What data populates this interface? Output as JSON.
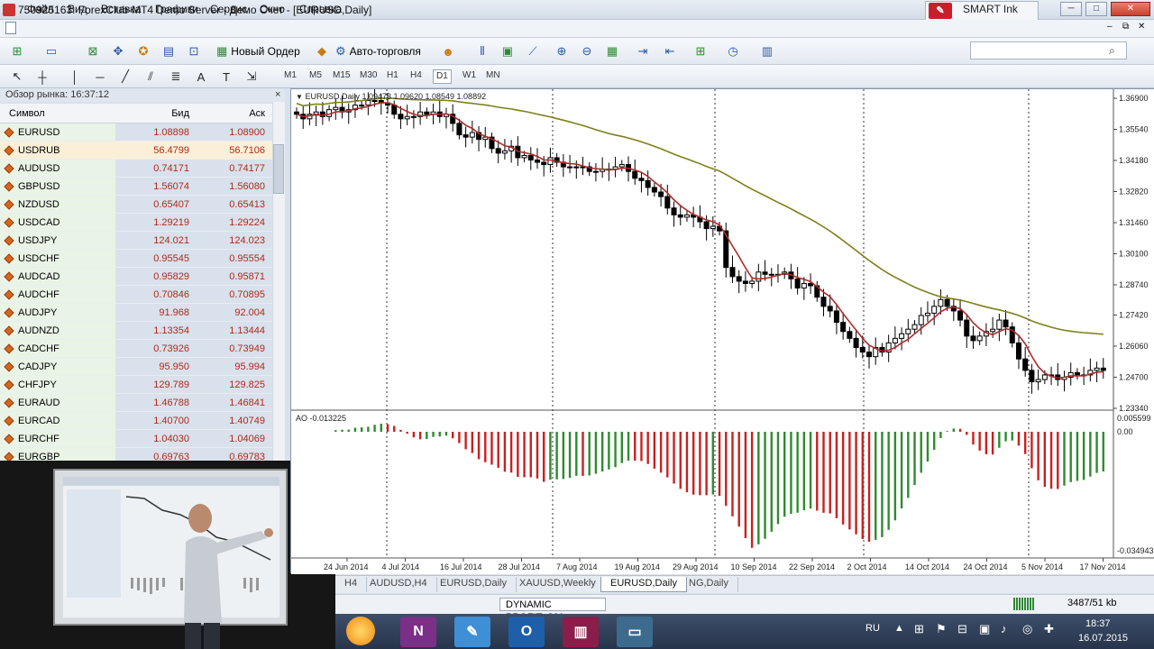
{
  "window": {
    "title": "750925163: ForexClub-MT4 Demo Server - Демо Счет - [EURUSD,Daily]",
    "smart_ink": "SMART Ink",
    "minimize": "─",
    "restore": "□",
    "close": "✕"
  },
  "menu": [
    "Файл",
    "Вид",
    "Вставка",
    "Графики",
    "Сервис",
    "Окно",
    "Справка"
  ],
  "toolbar": {
    "new_order": "Новый Ордер",
    "auto_trading": "Авто-торговля"
  },
  "timeframes": [
    "M1",
    "M5",
    "M15",
    "M30",
    "H1",
    "H4",
    "D1",
    "W1",
    "MN"
  ],
  "active_timeframe": "D1",
  "market_watch": {
    "header": "Обзор рынка: 16:37:12",
    "close": "×",
    "columns": [
      "Символ",
      "Бид",
      "Аск"
    ],
    "rows": [
      {
        "symbol": "EURUSD",
        "bid": "1.08898",
        "ask": "1.08900"
      },
      {
        "symbol": "USDRUB",
        "bid": "56.4799",
        "ask": "56.7106"
      },
      {
        "symbol": "AUDUSD",
        "bid": "0.74171",
        "ask": "0.74177"
      },
      {
        "symbol": "GBPUSD",
        "bid": "1.56074",
        "ask": "1.56080"
      },
      {
        "symbol": "NZDUSD",
        "bid": "0.65407",
        "ask": "0.65413"
      },
      {
        "symbol": "USDCAD",
        "bid": "1.29219",
        "ask": "1.29224"
      },
      {
        "symbol": "USDJPY",
        "bid": "124.021",
        "ask": "124.023"
      },
      {
        "symbol": "USDCHF",
        "bid": "0.95545",
        "ask": "0.95554"
      },
      {
        "symbol": "AUDCAD",
        "bid": "0.95829",
        "ask": "0.95871"
      },
      {
        "symbol": "AUDCHF",
        "bid": "0.70846",
        "ask": "0.70895"
      },
      {
        "symbol": "AUDJPY",
        "bid": "91.968",
        "ask": "92.004"
      },
      {
        "symbol": "AUDNZD",
        "bid": "1.13354",
        "ask": "1.13444"
      },
      {
        "symbol": "CADCHF",
        "bid": "0.73926",
        "ask": "0.73949"
      },
      {
        "symbol": "CADJPY",
        "bid": "95.950",
        "ask": "95.994"
      },
      {
        "symbol": "CHFJPY",
        "bid": "129.789",
        "ask": "129.825"
      },
      {
        "symbol": "EURAUD",
        "bid": "1.46788",
        "ask": "1.46841"
      },
      {
        "symbol": "EURCAD",
        "bid": "1.40700",
        "ask": "1.40749"
      },
      {
        "symbol": "EURCHF",
        "bid": "1.04030",
        "ask": "1.04069"
      },
      {
        "symbol": "EURGBP",
        "bid": "0.69763",
        "ask": "0.69783"
      }
    ]
  },
  "chart": {
    "header": "EURUSD,Daily  1.09473 1.09620 1.08549 1.08892",
    "indicator_label": "AO -0.013225",
    "price_levels": [
      "1.36900",
      "1.35540",
      "1.34180",
      "1.32820",
      "1.31460",
      "1.30100",
      "1.28740",
      "1.27420",
      "1.26060",
      "1.24700",
      "1.23340"
    ],
    "ao_levels": [
      "0.005599",
      "0.00",
      "-0.034943"
    ],
    "date_labels": [
      "24 Jun 2014",
      "4 Jul 2014",
      "16 Jul 2014",
      "28 Jul 2014",
      "7 Aug 2014",
      "19 Aug 2014",
      "29 Aug 2014",
      "10 Sep 2014",
      "22 Sep 2014",
      "2 Oct 2014",
      "14 Oct 2014",
      "24 Oct 2014",
      "5 Nov 2014",
      "17 Nov 2014"
    ],
    "colors": {
      "ma_fast": "#b02a2a",
      "ma_slow": "#7f7f1a",
      "ao_up": "#2e8b2e",
      "ao_down": "#c8201f"
    }
  },
  "chart_data": {
    "type": "candlestick",
    "symbol": "EURUSD",
    "timeframe": "Daily",
    "ylim": [
      1.2334,
      1.369
    ],
    "close_series": [
      1.362,
      1.36,
      1.362,
      1.363,
      1.361,
      1.364,
      1.365,
      1.363,
      1.364,
      1.366,
      1.366,
      1.368,
      1.368,
      1.367,
      1.366,
      1.362,
      1.36,
      1.361,
      1.361,
      1.363,
      1.362,
      1.363,
      1.361,
      1.362,
      1.358,
      1.353,
      1.352,
      1.354,
      1.351,
      1.352,
      1.347,
      1.345,
      1.346,
      1.348,
      1.343,
      1.344,
      1.342,
      1.341,
      1.34,
      1.343,
      1.341,
      1.339,
      1.339,
      1.339,
      1.339,
      1.337,
      1.337,
      1.338,
      1.338,
      1.339,
      1.34,
      1.337,
      1.334,
      1.333,
      1.33,
      1.328,
      1.326,
      1.321,
      1.318,
      1.317,
      1.318,
      1.317,
      1.315,
      1.312,
      1.313,
      1.311,
      1.295,
      1.291,
      1.289,
      1.288,
      1.289,
      1.293,
      1.292,
      1.292,
      1.292,
      1.293,
      1.29,
      1.286,
      1.288,
      1.287,
      1.282,
      1.278,
      1.276,
      1.271,
      1.267,
      1.264,
      1.26,
      1.258,
      1.256,
      1.26,
      1.258,
      1.262,
      1.264,
      1.266,
      1.268,
      1.27,
      1.274,
      1.275,
      1.278,
      1.281,
      1.278,
      1.276,
      1.272,
      1.265,
      1.263,
      1.265,
      1.267,
      1.268,
      1.272,
      1.269,
      1.262,
      1.255,
      1.25,
      1.245,
      1.246,
      1.248,
      1.248,
      1.246,
      1.247,
      1.249,
      1.248,
      1.248,
      1.25,
      1.251,
      1.25
    ]
  }
}
